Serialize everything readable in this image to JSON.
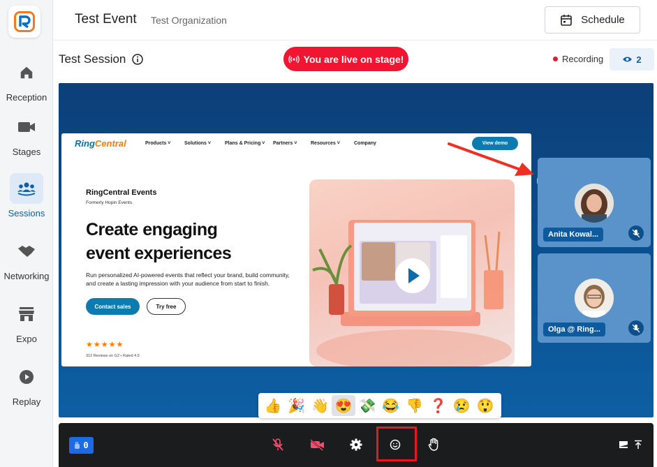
{
  "sidebar": {
    "items": [
      {
        "label": "Reception",
        "icon": "home-icon"
      },
      {
        "label": "Stages",
        "icon": "camera-icon"
      },
      {
        "label": "Sessions",
        "icon": "people-group-icon",
        "active": true
      },
      {
        "label": "Networking",
        "icon": "handshake-icon"
      },
      {
        "label": "Expo",
        "icon": "store-icon"
      },
      {
        "label": "Replay",
        "icon": "play-circle-icon"
      }
    ]
  },
  "header": {
    "event_title": "Test Event",
    "org_name": "Test Organization",
    "schedule_label": "Schedule"
  },
  "session": {
    "title": "Test Session",
    "live_label": "You are live on stage!",
    "recording_label": "Recording",
    "viewer_count": "2"
  },
  "screen_share": {
    "logo_part1": "Ring",
    "logo_part2": "Central",
    "nav": [
      "Products",
      "Solutions",
      "Plans & Pricing",
      "Partners",
      "Resources",
      "Company"
    ],
    "demo_label": "View demo",
    "brand": "RingCentral Events",
    "brand_sub": "Formerly Hopin Events",
    "headline_line1": "Create engaging",
    "headline_line2": "event experiences",
    "description": "Run personalized AI-powered events that reflect your brand, build community, and create a lasting impression with your audience from start to finish.",
    "cta_primary": "Contact sales",
    "cta_secondary": "Try free",
    "stars": "★★★★★",
    "rating": 4.5,
    "reviews": "312 Reviews on G2 • Rated 4.5"
  },
  "participants": [
    {
      "name": "Anita Kowal...",
      "muted": true
    },
    {
      "name": "Olga @ Ring...",
      "muted": true
    }
  ],
  "floating_reaction": "heart-eyes-emoji",
  "reactions": [
    {
      "emoji": "👍",
      "name": "thumbs-up"
    },
    {
      "emoji": "🎉",
      "name": "party-popper"
    },
    {
      "emoji": "👋",
      "name": "waving-hand"
    },
    {
      "emoji": "😍",
      "name": "heart-eyes",
      "selected": true
    },
    {
      "emoji": "💸",
      "name": "money-wings"
    },
    {
      "emoji": "😂",
      "name": "tears-of-joy"
    },
    {
      "emoji": "👎",
      "name": "thumbs-down"
    },
    {
      "emoji": "❓",
      "name": "question-mark"
    },
    {
      "emoji": "😢",
      "name": "crying-face"
    },
    {
      "emoji": "😲",
      "name": "astonished-face"
    }
  ],
  "controls": {
    "hand_count": "0",
    "buttons": [
      "mic-off-icon",
      "camera-off-icon",
      "settings-icon",
      "emoji-icon",
      "raise-hand-icon"
    ],
    "right": [
      "layout-icon",
      "expand-icon"
    ]
  },
  "colors": {
    "brand_blue": "#0a5fa8",
    "live_red": "#f21532",
    "stage_bg": "#0a4f8f",
    "controls_bg": "#1b1c1e",
    "highlight_red": "#e8161e"
  }
}
